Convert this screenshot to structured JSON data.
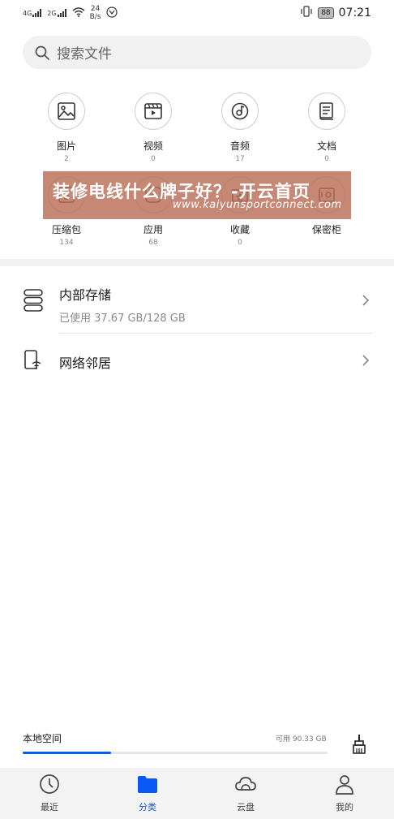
{
  "status_bar": {
    "sim1": "4G",
    "sim2": "2G",
    "speed_value": "24",
    "speed_unit": "B/s",
    "battery": "88",
    "time": "07:21"
  },
  "search": {
    "placeholder": "搜索文件"
  },
  "categories": [
    {
      "label": "图片",
      "count": "2",
      "icon": "image-icon"
    },
    {
      "label": "视频",
      "count": "0",
      "icon": "video-icon"
    },
    {
      "label": "音频",
      "count": "17",
      "icon": "music-icon"
    },
    {
      "label": "文档",
      "count": "0",
      "icon": "document-icon"
    },
    {
      "label": "压缩包",
      "count": "134",
      "icon": "archive-icon"
    },
    {
      "label": "应用",
      "count": "68",
      "icon": "app-icon"
    },
    {
      "label": "收藏",
      "count": "0",
      "icon": "star-icon"
    },
    {
      "label": "保密柜",
      "count": "",
      "icon": "safe-icon"
    }
  ],
  "banner": {
    "title": "装修电线什么牌子好？-开云首页",
    "url": "www.kaiyunsportconnect.com"
  },
  "storage_list": [
    {
      "title": "内部存储",
      "subtitle": "已使用 37.67 GB/128 GB",
      "icon": "storage-icon"
    },
    {
      "title": "网络邻居",
      "subtitle": "",
      "icon": "network-neighbor-icon"
    }
  ],
  "local_space": {
    "label": "本地空间",
    "available": "可用 90.33 GB",
    "used_fraction": 0.29
  },
  "nav": [
    {
      "label": "最近",
      "icon": "clock-icon",
      "active": false
    },
    {
      "label": "分类",
      "icon": "folder-icon",
      "active": true
    },
    {
      "label": "云盘",
      "icon": "cloud-icon",
      "active": false
    },
    {
      "label": "我的",
      "icon": "person-icon",
      "active": false
    }
  ],
  "colors": {
    "accent": "#0a59f7",
    "banner": "#b96e55"
  }
}
